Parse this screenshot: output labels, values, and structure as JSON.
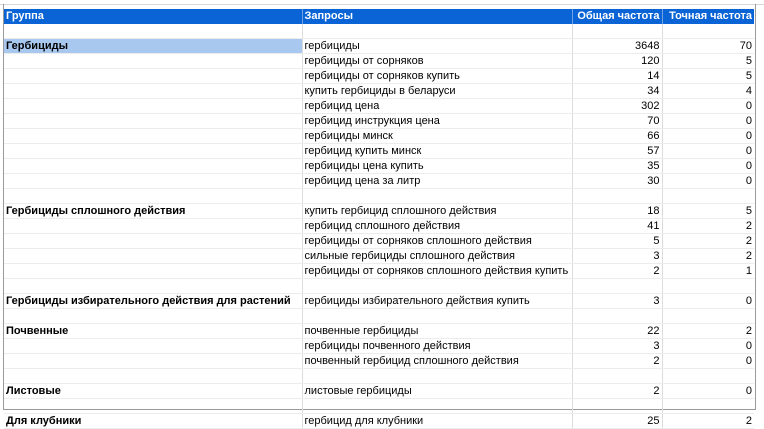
{
  "sheet": {
    "headers": {
      "group": "Группа",
      "query": "Запросы",
      "total": "Общая частота",
      "exact": "Точная частота"
    },
    "selection_color": "#a9c8f0",
    "header_color": "#0a64d6",
    "rows": [
      {
        "type": "spacer"
      },
      {
        "group": "Гербициды",
        "query": "гербициды",
        "total": "3648",
        "exact": "70",
        "selected": true
      },
      {
        "query": "гербициды от сорняков",
        "total": "120",
        "exact": "5"
      },
      {
        "query": "гербициды от сорняков купить",
        "total": "14",
        "exact": "5"
      },
      {
        "query": "купить гербициды в беларуси",
        "total": "34",
        "exact": "4"
      },
      {
        "query": "гербицид цена",
        "total": "302",
        "exact": "0"
      },
      {
        "query": "гербицид инструкция цена",
        "total": "70",
        "exact": "0"
      },
      {
        "query": "гербициды минск",
        "total": "66",
        "exact": "0"
      },
      {
        "query": "гербицид купить минск",
        "total": "57",
        "exact": "0"
      },
      {
        "query": "гербициды цена купить",
        "total": "35",
        "exact": "0"
      },
      {
        "query": "гербицид цена за литр",
        "total": "30",
        "exact": "0"
      },
      {
        "type": "spacer"
      },
      {
        "group": "Гербициды сплошного действия",
        "query": "купить гербицид сплошного действия",
        "total": "18",
        "exact": "5"
      },
      {
        "query": "гербицид сплошного действия",
        "total": "41",
        "exact": "2"
      },
      {
        "query": "гербициды от сорняков сплошного действия",
        "total": "5",
        "exact": "2"
      },
      {
        "query": "сильные гербициды сплошного действия",
        "total": "3",
        "exact": "2"
      },
      {
        "query": "гербициды от сорняков сплошного действия купить",
        "total": "2",
        "exact": "1"
      },
      {
        "type": "spacer"
      },
      {
        "group": "Гербициды избирательного действия для растений",
        "query": "гербициды избирательного действия купить",
        "total": "3",
        "exact": "0"
      },
      {
        "type": "spacer"
      },
      {
        "group": "Почвенные",
        "query": "почвенные гербициды",
        "total": "22",
        "exact": "2"
      },
      {
        "query": "гербициды почвенного действия",
        "total": "3",
        "exact": "0"
      },
      {
        "query": "почвенный гербицид сплошного действия",
        "total": "2",
        "exact": "0"
      },
      {
        "type": "spacer"
      },
      {
        "group": "Листовые",
        "query": "листовые гербициды",
        "total": "2",
        "exact": "0"
      },
      {
        "type": "spacer"
      },
      {
        "group": "Для клубники",
        "query": "гербицид для клубники",
        "total": "25",
        "exact": "2"
      }
    ]
  }
}
